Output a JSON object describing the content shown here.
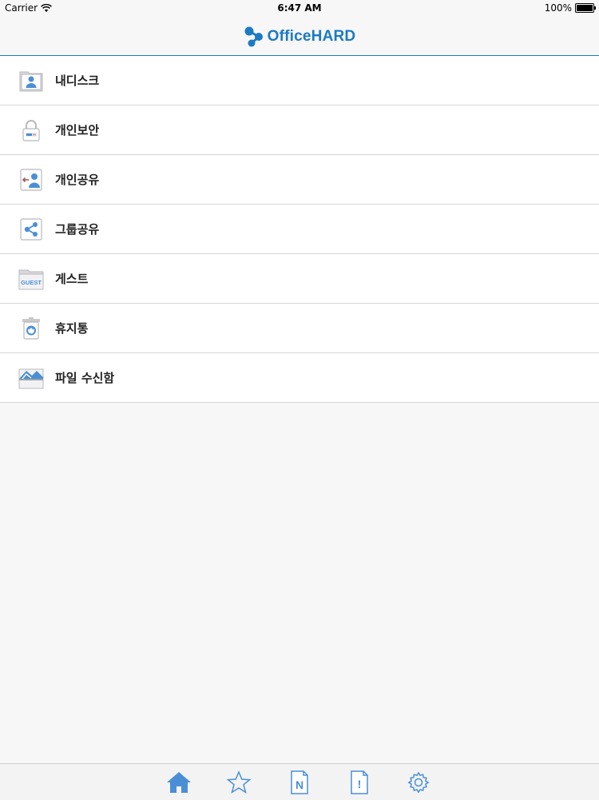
{
  "status_bar": {
    "carrier": "Carrier",
    "time": "6:47 AM",
    "battery": "100%",
    "battery_level": 1.0
  },
  "nav_bar": {
    "logo_text": "OfficeHARD"
  },
  "menu": {
    "items": [
      {
        "label": "내디스크",
        "icon": "my-disk-icon"
      },
      {
        "label": "개인보안",
        "icon": "lock-icon"
      },
      {
        "label": "개인공유",
        "icon": "personal-share-icon"
      },
      {
        "label": "그룹공유",
        "icon": "share-icon"
      },
      {
        "label": "게스트",
        "icon": "guest-folder-icon"
      },
      {
        "label": "휴지통",
        "icon": "trash-icon"
      },
      {
        "label": "파일 수신함",
        "icon": "inbox-icon"
      }
    ],
    "guest_icon_text": "GUEST"
  },
  "tab_bar": {
    "tabs": [
      {
        "icon": "home-icon",
        "active": true
      },
      {
        "icon": "star-icon",
        "active": false
      },
      {
        "icon": "note-icon",
        "active": false
      },
      {
        "icon": "notice-icon",
        "active": false
      },
      {
        "icon": "gear-icon",
        "active": false
      }
    ],
    "note_letter": "N",
    "notice_mark": "!"
  },
  "colors": {
    "accent": "#1b7ac3",
    "icon_blue": "#4a8fd6",
    "separator": "#d5d5d8"
  }
}
